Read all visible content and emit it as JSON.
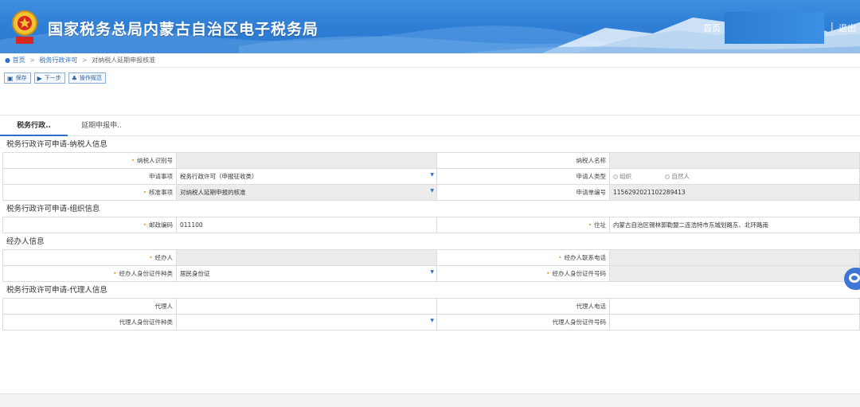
{
  "header": {
    "title": "国家税务总局内蒙古自治区电子税务局",
    "home": "首页",
    "sep": "|",
    "logout": "退出",
    "accent": "#2f7fd6"
  },
  "breadcrumb": {
    "home": "首页",
    "level1": "税务行政许可",
    "current": "对纳税人延期申报核准",
    "sep": ">"
  },
  "toolbar": {
    "save": "保存",
    "next": "下一步",
    "guide": "操作规范"
  },
  "tabs": [
    {
      "label": "税务行政.."
    },
    {
      "label": "延期申报申.."
    }
  ],
  "sections": {
    "taxpayer": {
      "title": "税务行政许可申请-纳税人信息",
      "taxpayer_id_label": "纳税人识别号",
      "taxpayer_id_value": "",
      "taxpayer_name_label": "纳税人名称",
      "taxpayer_name_value": "",
      "apply_item_label": "申请事项",
      "apply_item_value": "税务行政许可（申报征收类）",
      "applicant_type_label": "申请人类型",
      "applicant_type_opt1": "组织",
      "applicant_type_opt2": "自然人",
      "approve_item_label": "核准事项",
      "approve_item_value": "对纳税人延期申报的核准",
      "apply_no_label": "申请单编号",
      "apply_no_value": "115629202110228941З"
    },
    "org": {
      "title": "税务行政许可申请-组织信息",
      "postcode_label": "邮政编码",
      "postcode_value": "011100",
      "address_label": "住址",
      "address_value": "内蒙古自治区锡林郭勒盟二连浩特市东城划路东、北环路南"
    },
    "handler": {
      "title": "经办人信息",
      "handler_label": "经办人",
      "handler_value": "",
      "phone_label": "经办人联系电话",
      "phone_value": "",
      "id_type_label": "经办人身份证件种类",
      "id_type_value": "居民身份证",
      "id_no_label": "经办人身份证件号码",
      "id_no_value": ""
    },
    "agent": {
      "title": "税务行政许可申请-代理人信息",
      "agent_label": "代理人",
      "agent_phone_label": "代理人电话",
      "agent_id_type_label": "代理人身份证件种类",
      "agent_id_no_label": "代理人身份证件号码"
    }
  }
}
